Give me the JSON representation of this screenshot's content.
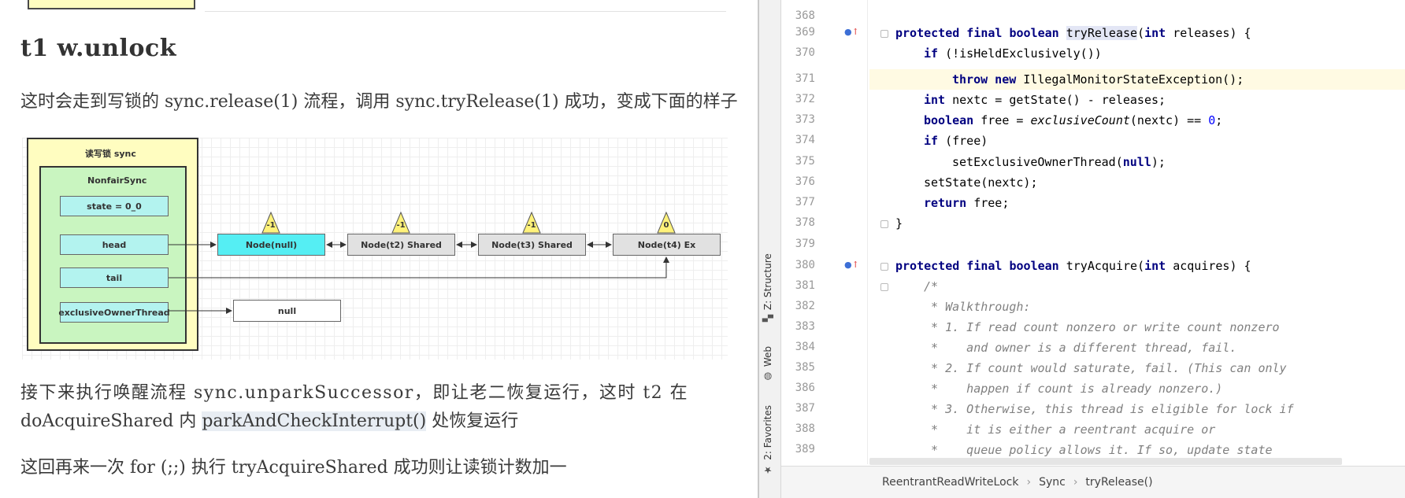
{
  "document": {
    "heading": "t1 w.unlock",
    "para1": "这时会走到写锁的 sync.release(1) 流程，调用 sync.tryRelease(1) 成功，变成下面的样子",
    "para2_line1": "接下来执行唤醒流程 sync.unparkSuccessor，即让老二恢复运行，这时 t2 在",
    "para2_line2_a": "doAcquireShared 内 ",
    "para2_line2_hl": "parkAndCheckInterrupt()",
    "para2_line2_b": " 处恢复运行",
    "para3": "这回再来一次 for (;;) 执行 tryAcquireShared 成功则让读锁计数加一"
  },
  "diagram": {
    "outer_title": "读写锁 sync",
    "inner_title": "NonfairSync",
    "fields": [
      "state = 0_0",
      "head",
      "tail",
      "exclusiveOwnerThread"
    ],
    "nodes": [
      "Node(null)",
      "Node(t2) Shared",
      "Node(t3) Shared",
      "Node(t4) Ex"
    ],
    "node_waitstatus": [
      "-1",
      "-1",
      "-1",
      "0"
    ],
    "owner_value": "null"
  },
  "ide": {
    "side_tabs": [
      "Z: Structure",
      "Web",
      "2: Favorites"
    ],
    "line_numbers": [
      "368",
      "369",
      "370",
      "371",
      "372",
      "373",
      "374",
      "375",
      "376",
      "377",
      "378",
      "379",
      "380",
      "381",
      "382",
      "383",
      "384",
      "385",
      "386",
      "387",
      "388",
      "389"
    ],
    "code": {
      "l369_kw": "protected final boolean ",
      "l369_m": "tryRelease",
      "l369_rest_a": "(",
      "l369_kw2": "int",
      "l369_rest_b": " releases) {",
      "l370_kw": "if",
      "l370_rest": " (!isHeldExclusively())",
      "l371_kw": "throw new",
      "l371_rest": " IllegalMonitorStateException();",
      "l372_kw": "int",
      "l372_rest": " nextc = getState() - releases;",
      "l373_kw": "boolean",
      "l373_a": " free = ",
      "l373_it": "exclusiveCount",
      "l373_b": "(nextc) == ",
      "l373_num": "0",
      "l373_c": ";",
      "l374_kw": "if",
      "l374_rest": " (free)",
      "l375_a": "setExclusiveOwnerThread(",
      "l375_kw": "null",
      "l375_b": ");",
      "l376": "setState(nextc);",
      "l377_kw": "return",
      "l377_rest": " free;",
      "l378": "}",
      "l380_kw": "protected final boolean ",
      "l380_m": "tryAcquire",
      "l380_rest_a": "(",
      "l380_kw2": "int",
      "l380_rest_b": " acquires) {",
      "l381": "/*",
      "l382": " * Walkthrough:",
      "l383": " * 1. If read count nonzero or write count nonzero",
      "l384": " *    and owner is a different thread, fail.",
      "l385": " * 2. If count would saturate, fail. (This can only",
      "l386": " *    happen if count is already nonzero.)",
      "l387": " * 3. Otherwise, this thread is eligible for lock if",
      "l388": " *    it is either a reentrant acquire or",
      "l389": " *    queue policy allows it. If so, update state"
    },
    "breadcrumb": [
      "ReentrantReadWriteLock",
      "Sync",
      "tryRelease()"
    ]
  },
  "colors": {
    "outer_box": "#fffdc0",
    "inner_box": "#c9f5c0",
    "field_box": "#b3f3ef",
    "head_node": "#55eef3",
    "node": "#e1e1e1",
    "triangle": "#fff27a",
    "keyword": "#000080",
    "number": "#0000ff",
    "comment": "#808080"
  }
}
